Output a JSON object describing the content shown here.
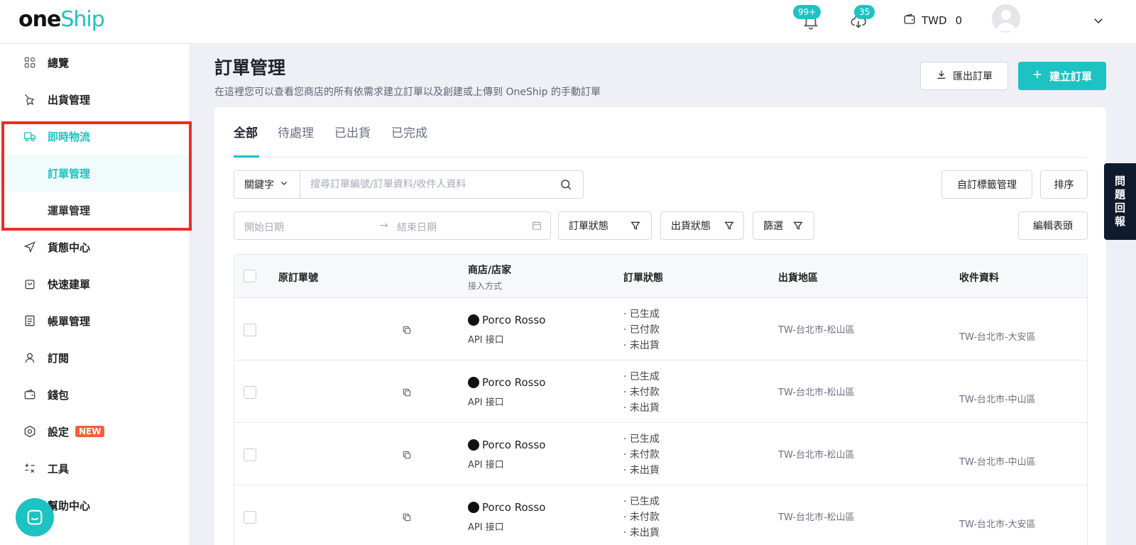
{
  "brand": {
    "one": "one",
    "ship": "Ship"
  },
  "topbar": {
    "notifications_count": "99+",
    "downloads_count": "35",
    "currency": "TWD",
    "balance": "0"
  },
  "sidebar": {
    "items": [
      {
        "label": "總覽",
        "icon": "grid-icon"
      },
      {
        "label": "出貨管理",
        "icon": "shipping-icon"
      },
      {
        "label": "即時物流",
        "icon": "delivery-icon"
      },
      {
        "label": "訂單管理"
      },
      {
        "label": "運單管理"
      },
      {
        "label": "貨態中心",
        "icon": "send-icon"
      },
      {
        "label": "快速建單",
        "icon": "bag-icon"
      },
      {
        "label": "帳單管理",
        "icon": "bill-icon"
      },
      {
        "label": "訂閱",
        "icon": "user-icon"
      },
      {
        "label": "錢包",
        "icon": "wallet-icon"
      },
      {
        "label": "設定",
        "icon": "gear-icon",
        "badge": "NEW"
      },
      {
        "label": "工具",
        "icon": "tools-icon"
      },
      {
        "label": "幫助中心",
        "icon": "help-icon"
      }
    ]
  },
  "page": {
    "title": "訂單管理",
    "description": "在這裡您可以查看您商店的所有依需求建立訂單以及創建或上傳到 OneShip 的手動訂單",
    "export_label": "匯出訂單",
    "create_label": "建立訂單"
  },
  "tabs": [
    "全部",
    "待處理",
    "已出貨",
    "已完成"
  ],
  "filters": {
    "keyword_label": "關鍵字",
    "search_placeholder": "搜尋訂單編號/訂單資料/收件人資料",
    "custom_tags_label": "自訂標籤管理",
    "sort_label": "排序",
    "start_date_placeholder": "開始日期",
    "end_date_placeholder": "結束日期",
    "order_status_label": "訂單狀態",
    "shipping_status_label": "出貨狀態",
    "filter_label": "篩選",
    "edit_columns_label": "編輯表頭"
  },
  "table": {
    "headers": {
      "order_no": "原訂單號",
      "store": "商店/店家",
      "store_sub": "接入方式",
      "status": "訂單狀態",
      "ship_region": "出貨地區",
      "recipient": "收件資料"
    },
    "rows": [
      {
        "store": "Porco Rosso",
        "channel": "API 接口",
        "status": [
          "· 已生成",
          "· 已付款",
          "· 未出貨"
        ],
        "ship_region": "TW-台北市-松山區",
        "recipient": "TW-台北市-大安區"
      },
      {
        "store": "Porco Rosso",
        "channel": "API 接口",
        "status": [
          "· 已生成",
          "· 未付款",
          "· 未出貨"
        ],
        "ship_region": "TW-台北市-松山區",
        "recipient": "TW-台北市-中山區"
      },
      {
        "store": "Porco Rosso",
        "channel": "API 接口",
        "status": [
          "· 已生成",
          "· 未付款",
          "· 未出貨"
        ],
        "ship_region": "TW-台北市-松山區",
        "recipient": "TW-台北市-中山區"
      },
      {
        "store": "Porco Rosso",
        "channel": "API 接口",
        "status": [
          "· 已生成",
          "· 未付款",
          "· 未出貨"
        ],
        "ship_region": "TW-台北市-松山區",
        "recipient": "TW-台北市-大安區"
      }
    ]
  },
  "feedback_tab": [
    "問",
    "題",
    "回",
    "報"
  ],
  "colors": {
    "accent": "#1dc2c2",
    "highlight": "#ef2c22",
    "new_badge": "#f5603a"
  }
}
